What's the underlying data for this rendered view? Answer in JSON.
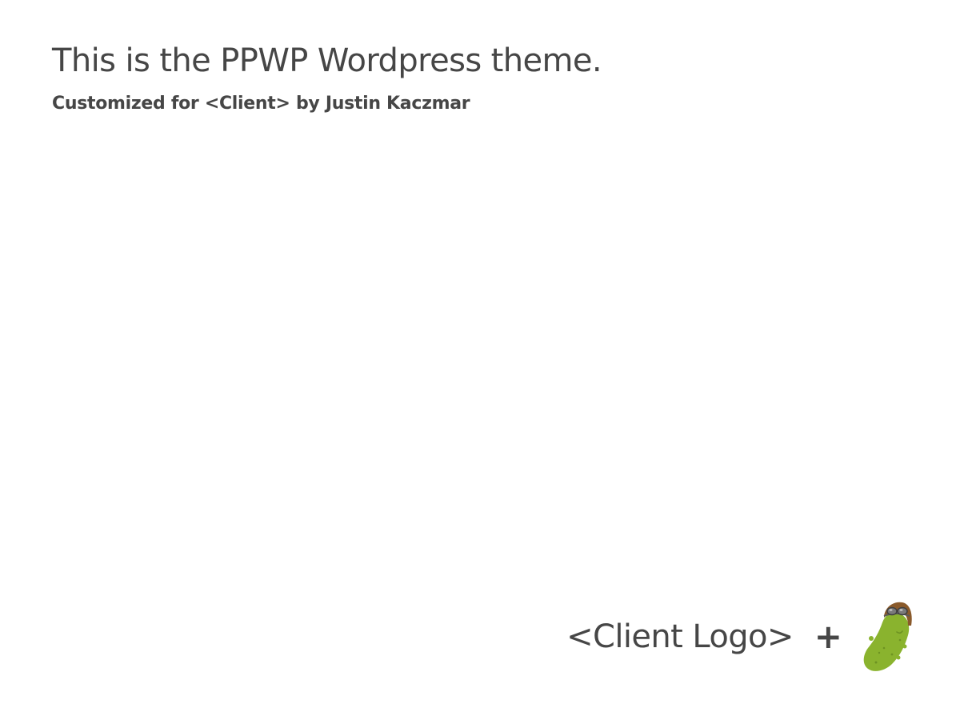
{
  "header": {
    "title": "This is the PPWP Wordpress theme.",
    "subtitle": "Customized for <Client> by Justin Kaczmar"
  },
  "footer": {
    "client_logo_text": "<Client Logo>",
    "plus": "+",
    "logo_icon": "pickle-with-aviator-goggles-icon"
  },
  "colors": {
    "text": "#464646",
    "background": "#ffffff",
    "pickle_green": "#8ab32e",
    "pickle_dark": "#6d9322",
    "helmet_brown": "#8a5a2b",
    "goggles": "#7a7a7a"
  }
}
